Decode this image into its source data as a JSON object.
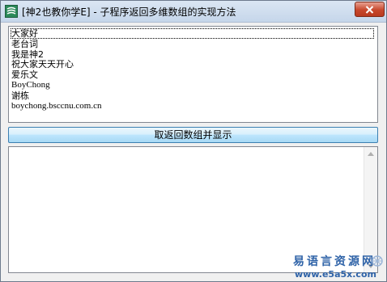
{
  "window": {
    "title": "[神2也教你学E] - 子程序返回多维数组的实现方法",
    "close_icon": "close-icon",
    "app_icon": "epl-app-icon"
  },
  "listbox": {
    "items": [
      {
        "text": "大家好",
        "selected": true
      },
      {
        "text": "老台词",
        "selected": false
      },
      {
        "text": "我是神2",
        "selected": false
      },
      {
        "text": "祝大家天天开心",
        "selected": false
      },
      {
        "text": "爱乐文",
        "selected": false
      },
      {
        "text": "BoyChong",
        "selected": false
      },
      {
        "text": "谢栋",
        "selected": false
      },
      {
        "text": "boychong.bsccnu.com.cn",
        "selected": false
      }
    ]
  },
  "button": {
    "label": "取返回数组并显示"
  },
  "textbox": {
    "value": ""
  },
  "watermark": {
    "title": "易语言资源网",
    "url": "www.e5a5x.com"
  },
  "colors": {
    "title_bg": "#c5d6ea",
    "close_btn": "#c7472c",
    "button_bg": "#bee6fd",
    "watermark": "#2f63a8"
  }
}
